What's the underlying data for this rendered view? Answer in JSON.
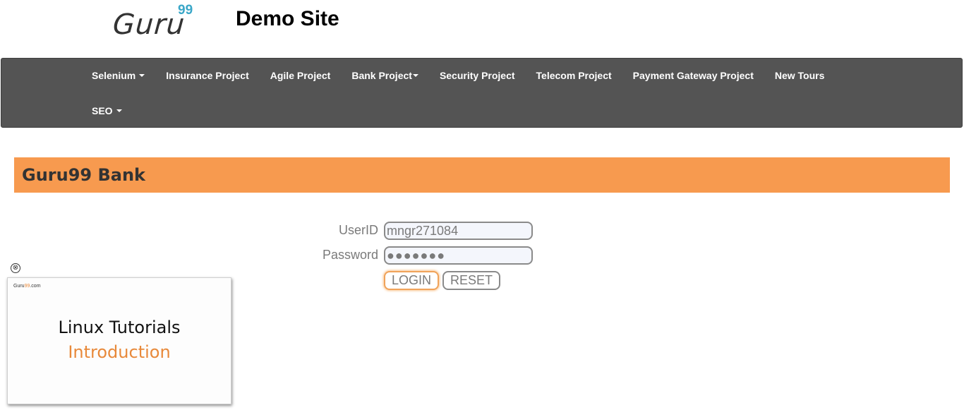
{
  "header": {
    "logo_text": "Guru",
    "logo_superscript": "99",
    "site_title": "Demo Site"
  },
  "navbar": {
    "items": [
      {
        "label": "Selenium",
        "dropdown": true
      },
      {
        "label": "Insurance Project",
        "dropdown": false
      },
      {
        "label": "Agile Project",
        "dropdown": false
      },
      {
        "label": "Bank Project",
        "dropdown": true
      },
      {
        "label": "Security Project",
        "dropdown": false
      },
      {
        "label": "Telecom Project",
        "dropdown": false
      },
      {
        "label": "Payment Gateway Project",
        "dropdown": false
      },
      {
        "label": "New Tours",
        "dropdown": false
      },
      {
        "label": "SEO",
        "dropdown": true
      }
    ]
  },
  "bank": {
    "title": "Guru99 Bank"
  },
  "login_form": {
    "userid_label": "UserID",
    "userid_value": "mngr271084",
    "password_label": "Password",
    "password_masked": "●●●●●●●",
    "login_button": "LOGIN",
    "reset_button": "RESET"
  },
  "video_ad": {
    "close_icon": "⊗",
    "brand_prefix": "Guru",
    "brand_accent": "99",
    "brand_suffix": ".com",
    "title": "Linux Tutorials",
    "subtitle": "Introduction"
  },
  "colors": {
    "navbar_bg": "#545454",
    "banner_bg": "#f79a4f",
    "logo_accent": "#3aa7c8",
    "video_accent": "#e8893a"
  }
}
